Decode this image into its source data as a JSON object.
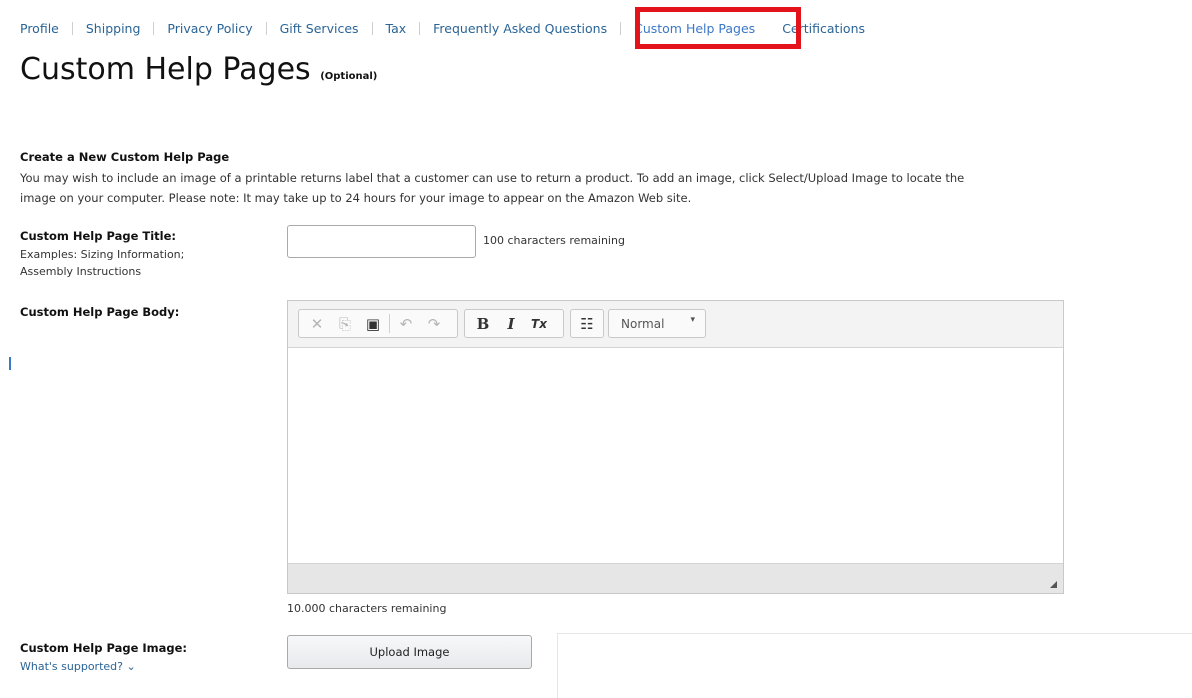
{
  "nav": {
    "items": [
      "Profile",
      "Shipping",
      "Privacy Policy",
      "Gift Services",
      "Tax",
      "Frequently Asked Questions",
      "Custom Help Pages",
      "Certifications"
    ],
    "active_index": 6,
    "highlight_color": "#e3121b",
    "link_color": "#2a6496"
  },
  "page": {
    "title": "Custom Help Pages",
    "title_suffix": "(Optional)"
  },
  "create_section": {
    "heading": "Create a New Custom Help Page",
    "intro_line1": "You may wish to include an image of a printable returns label that a customer can use to return a product. To add an image, click Select/Upload Image to locate the",
    "intro_line2": "image on your computer. Please note: It may take up to 24 hours for your image to appear on the Amazon Web site."
  },
  "title_field": {
    "label": "Custom Help Page Title:",
    "hint_line1": "Examples: Sizing Information;",
    "hint_line2": "Assembly Instructions",
    "value": "",
    "counter": "100 characters remaining"
  },
  "body_field": {
    "label": "Custom Help Page Body:",
    "counter": "10.000 characters remaining",
    "toolbar": {
      "cut_icon": "✕",
      "copy_icon": "⎘",
      "paste_icon": "▣",
      "undo_icon": "↶",
      "redo_icon": "↷",
      "bold": "B",
      "italic": "I",
      "remove_format": "Tx",
      "bullets_icon": "☷",
      "format_value": "Normal",
      "format_caret": "▾"
    }
  },
  "image_field": {
    "label": "Custom Help Page Image:",
    "supported_link": "What's supported? ⌄",
    "upload_label": "Upload Image"
  }
}
